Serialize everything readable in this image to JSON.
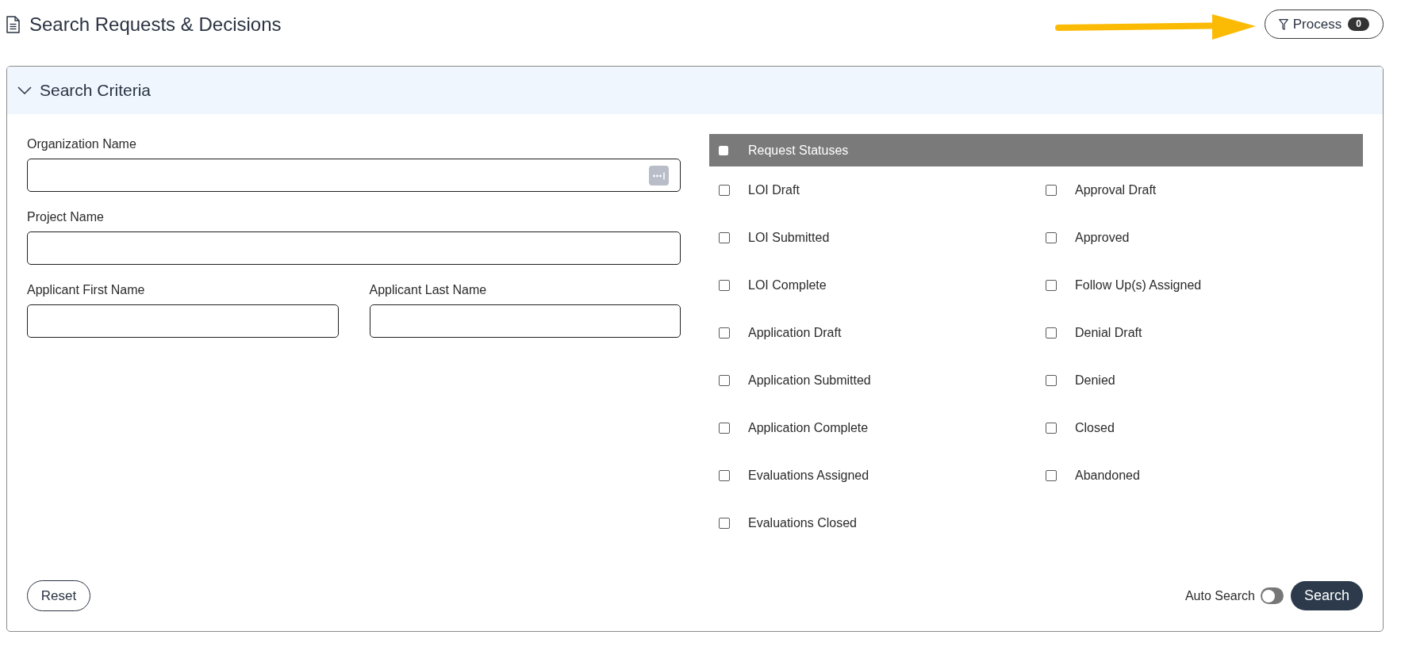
{
  "page": {
    "title": "Search Requests & Decisions"
  },
  "process_button": {
    "label": "Process",
    "count": "0"
  },
  "search_criteria": {
    "title": "Search Criteria",
    "expanded": true,
    "field_rows": [
      [
        {
          "label": "Organization Name",
          "kind": "lookup"
        }
      ],
      [
        {
          "label": "Project Name",
          "kind": "text"
        }
      ],
      [
        {
          "label": "Applicant First Name",
          "kind": "text"
        },
        {
          "label": "Applicant Last Name",
          "kind": "text"
        }
      ]
    ],
    "request_statuses": {
      "title": "Request Statuses",
      "checked": false,
      "columns": [
        [
          {
            "label": "LOI Draft",
            "checked": false
          },
          {
            "label": "LOI Submitted",
            "checked": false
          },
          {
            "label": "LOI Complete",
            "checked": false
          },
          {
            "label": "Application Draft",
            "checked": false
          },
          {
            "label": "Application Submitted",
            "checked": false
          },
          {
            "label": "Application Complete",
            "checked": false
          },
          {
            "label": "Evaluations Assigned",
            "checked": false
          },
          {
            "label": "Evaluations Closed",
            "checked": false
          }
        ],
        [
          {
            "label": "Approval Draft",
            "checked": false
          },
          {
            "label": "Approved",
            "checked": false
          },
          {
            "label": "Follow Up(s) Assigned",
            "checked": false
          },
          {
            "label": "Denial Draft",
            "checked": false
          },
          {
            "label": "Denied",
            "checked": false
          },
          {
            "label": "Closed",
            "checked": false
          },
          {
            "label": "Abandoned",
            "checked": false
          }
        ]
      ]
    },
    "reset_button": "Reset",
    "auto_search": {
      "label": "Auto Search",
      "on": false
    },
    "search_button": "Search"
  }
}
